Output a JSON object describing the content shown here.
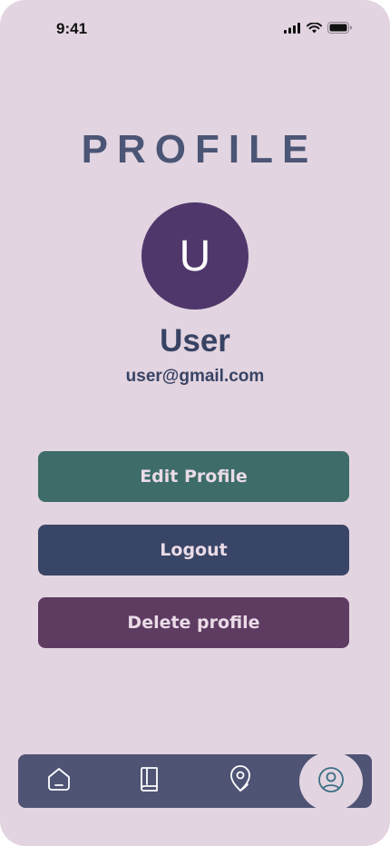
{
  "status_bar": {
    "time": "9:41",
    "icons": [
      "cellular-signal-icon",
      "wifi-icon",
      "battery-icon"
    ]
  },
  "header": {
    "title": "PROFILE"
  },
  "profile": {
    "avatar_initial": "U",
    "name": "User",
    "email": "user@gmail.com"
  },
  "actions": {
    "edit_label": "Edit Profile",
    "logout_label": "Logout",
    "delete_label": "Delete profile"
  },
  "bottom_nav": {
    "items": [
      {
        "icon": "home-icon"
      },
      {
        "icon": "book-icon"
      },
      {
        "icon": "map-pin-icon"
      },
      {
        "icon": "profile-icon",
        "active": true
      }
    ]
  },
  "colors": {
    "background": "#e2d4e0",
    "title": "#4b5576",
    "avatar": "#4f376c",
    "edit_button": "#3e6d69",
    "logout_button": "#394566",
    "delete_button": "#5e3c62",
    "nav_bar": "#4f5475"
  }
}
